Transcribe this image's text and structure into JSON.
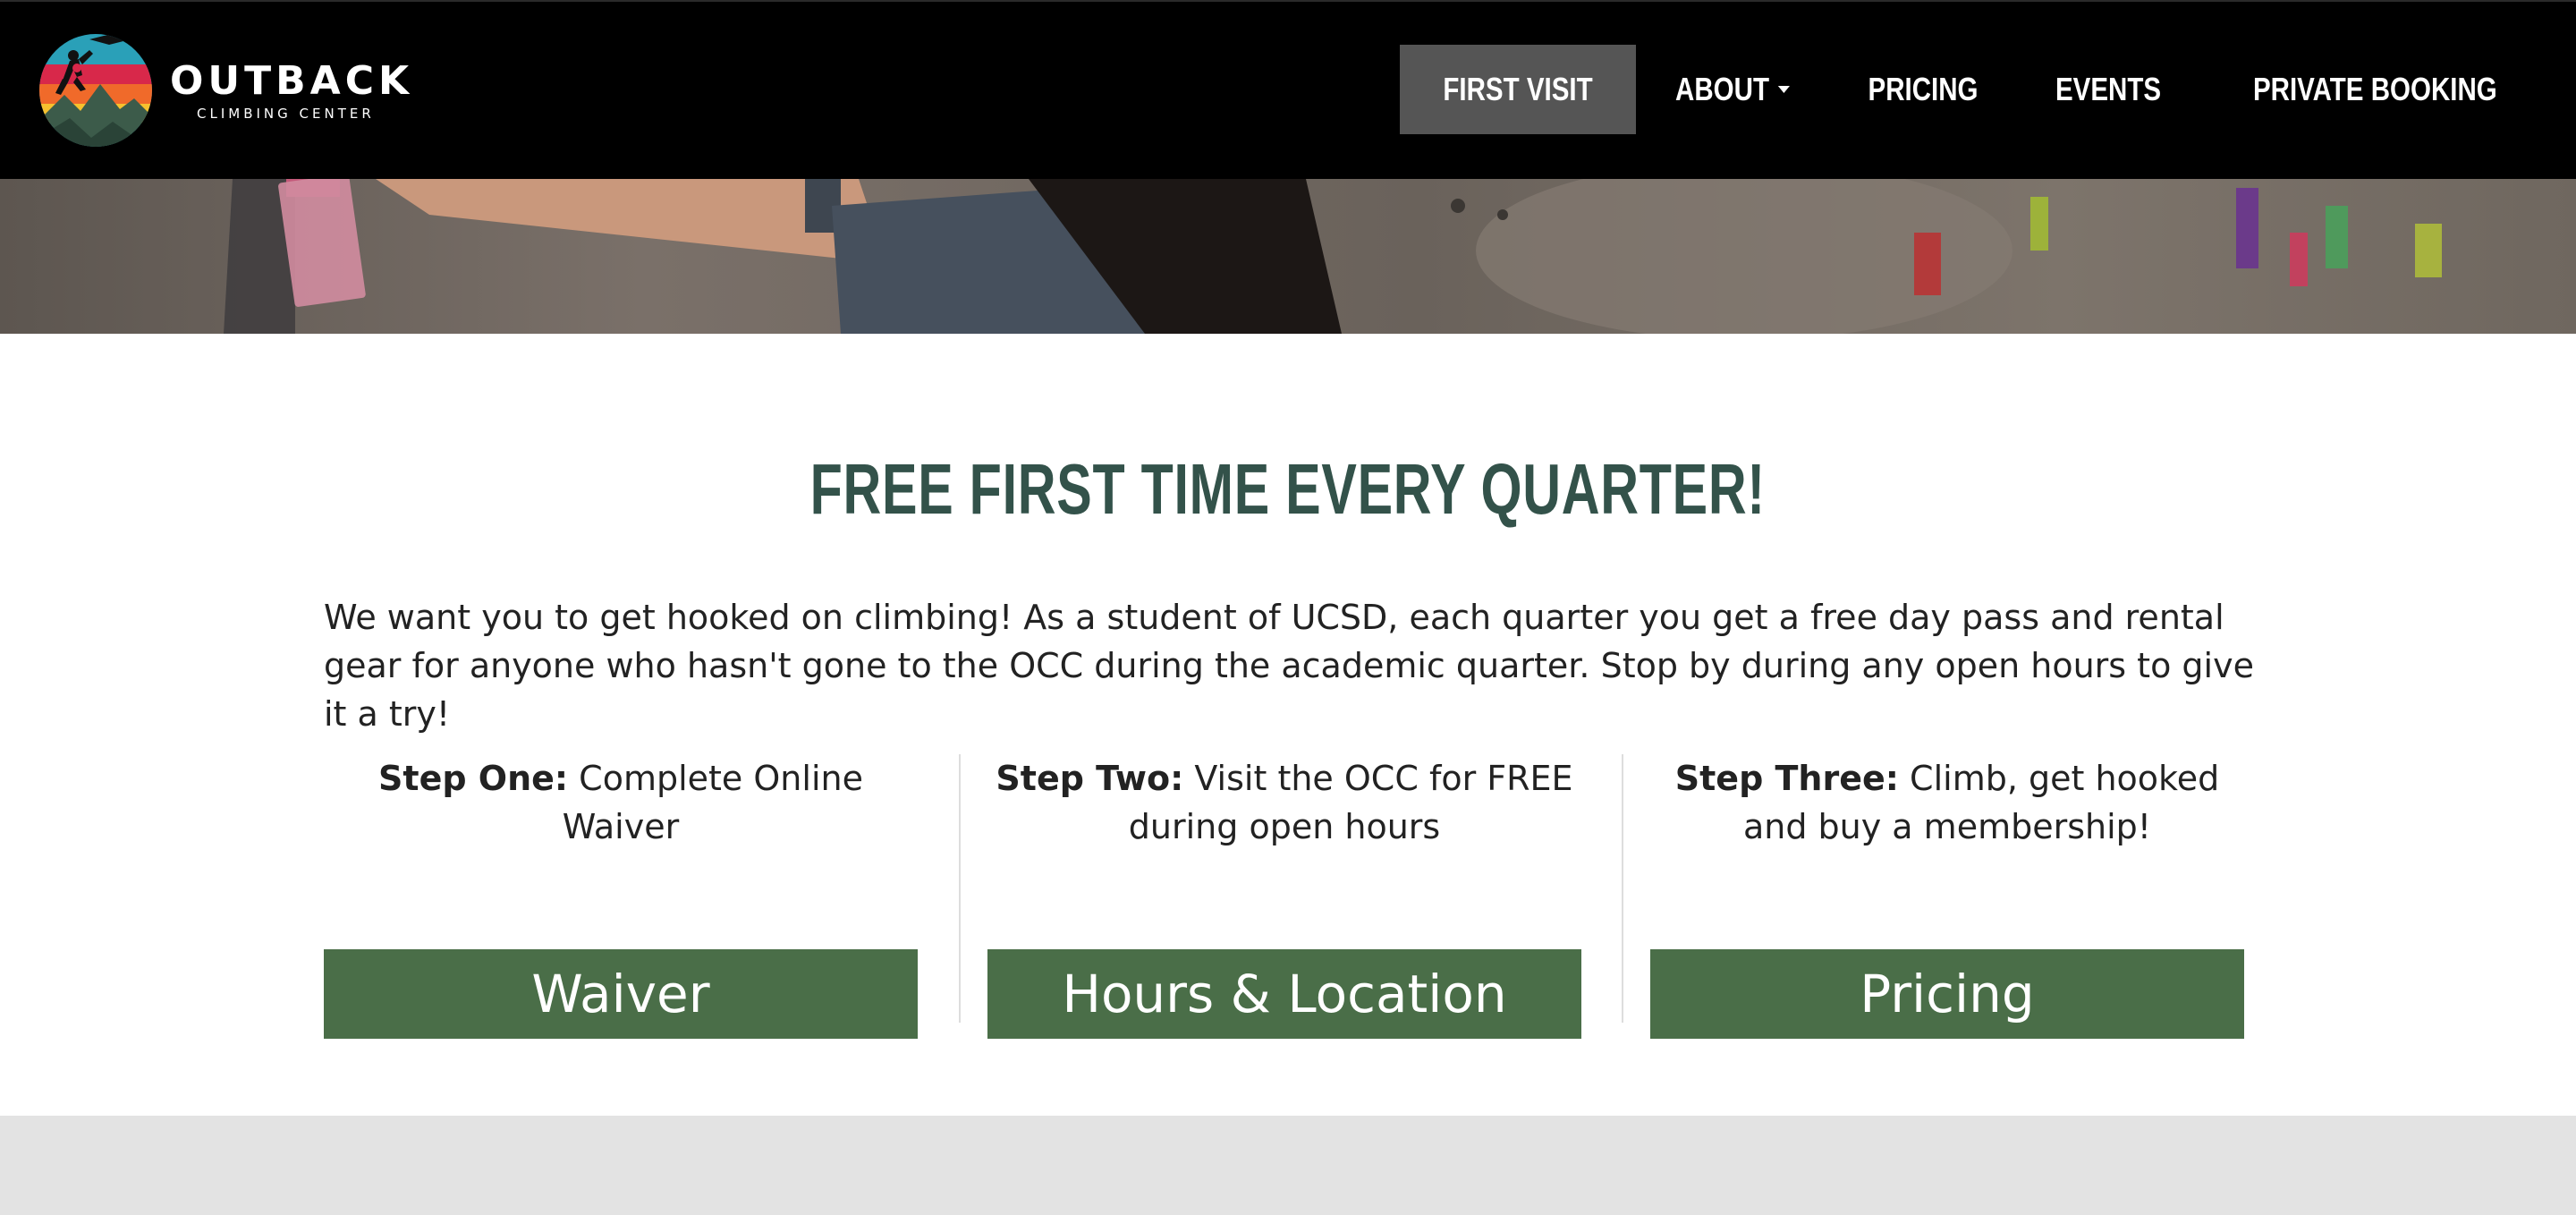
{
  "brand": {
    "name": "OUTBACK",
    "subtitle": "CLIMBING CENTER"
  },
  "nav": {
    "items": [
      {
        "label": "FIRST VISIT",
        "active": true
      },
      {
        "label": "ABOUT",
        "has_dropdown": true
      },
      {
        "label": "PRICING"
      },
      {
        "label": "EVENTS"
      },
      {
        "label": "PRIVATE BOOKING"
      }
    ]
  },
  "main": {
    "headline": "FREE FIRST TIME EVERY QUARTER!",
    "intro": "We want you to get hooked on climbing! As a student of UCSD, each quarter you get a free day pass and rental gear for anyone who hasn't gone to the OCC during the academic quarter. Stop by during any open hours to give it a try!",
    "steps": [
      {
        "lead": "Step One:",
        "text": " Complete Online Waiver",
        "button": "Waiver"
      },
      {
        "lead": "Step Two:",
        "text": " Visit the OCC for FREE during open hours",
        "button": "Hours & Location"
      },
      {
        "lead": "Step Three:",
        "text": " Climb, get hooked and buy a membership!",
        "button": "Pricing"
      }
    ]
  },
  "colors": {
    "navbar": "#000000",
    "nav_active": "#555555",
    "headline": "#33524a",
    "button": "#4a6e48",
    "footer_band": "#e3e3e3"
  }
}
